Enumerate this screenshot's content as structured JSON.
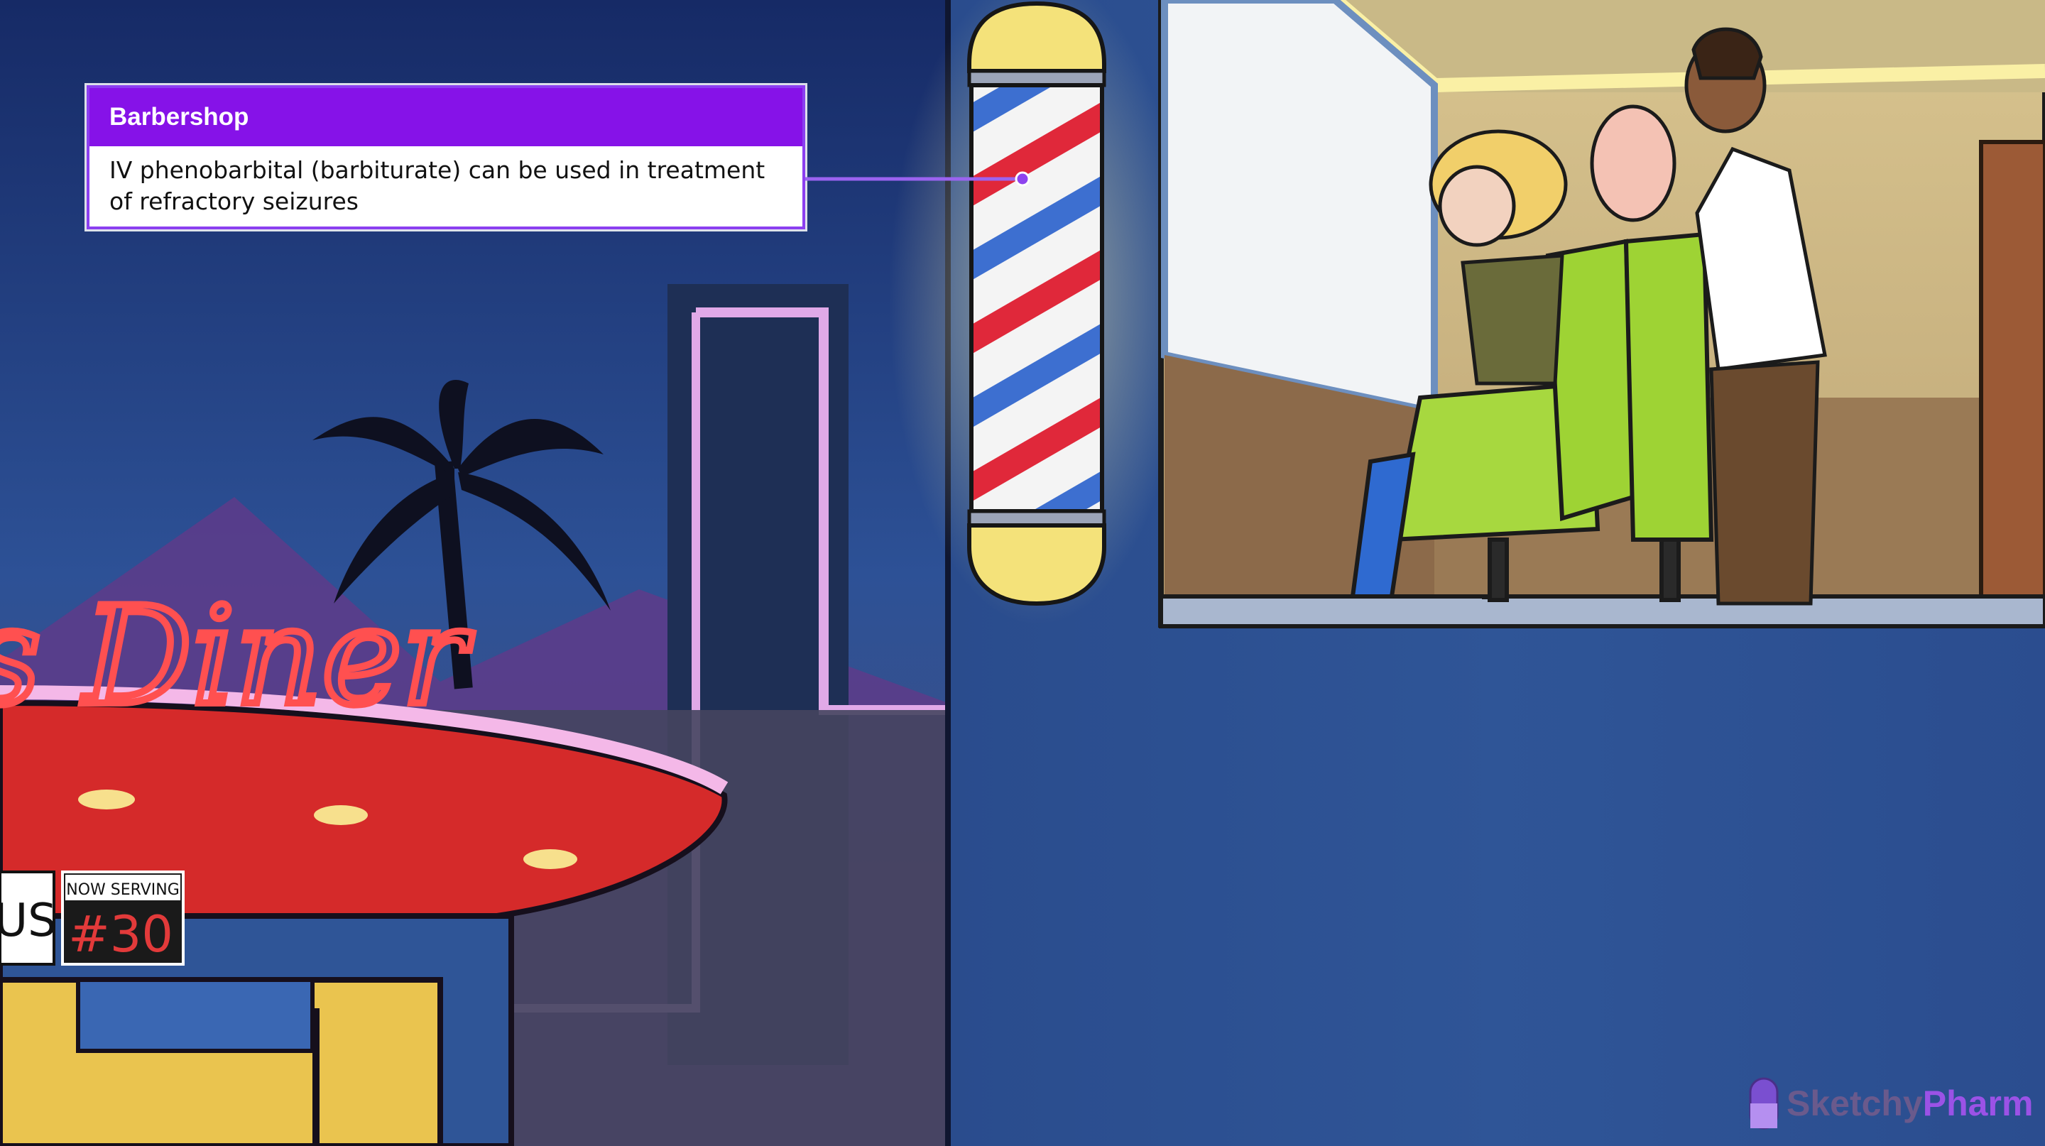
{
  "callout": {
    "title": "Barbershop",
    "text": "IV phenobarbital (barbiturate) can be used in treatment of refractory seizures"
  },
  "diner": {
    "sign": "s Diner",
    "board_left": "US",
    "board_label": "NOW SERVING",
    "board_number": "#30"
  },
  "brand": {
    "name_part1": "Sketchy",
    "name_part2": "Pharm"
  },
  "colors": {
    "callout_header": "#8612e8",
    "night_sky": "#1e3a80",
    "wall_blue": "#2f5597",
    "neon_red": "#e23a3a",
    "chair_green": "#9ed334",
    "barber_pole_red": "#e0283a",
    "barber_pole_blue": "#3d6fd0"
  }
}
